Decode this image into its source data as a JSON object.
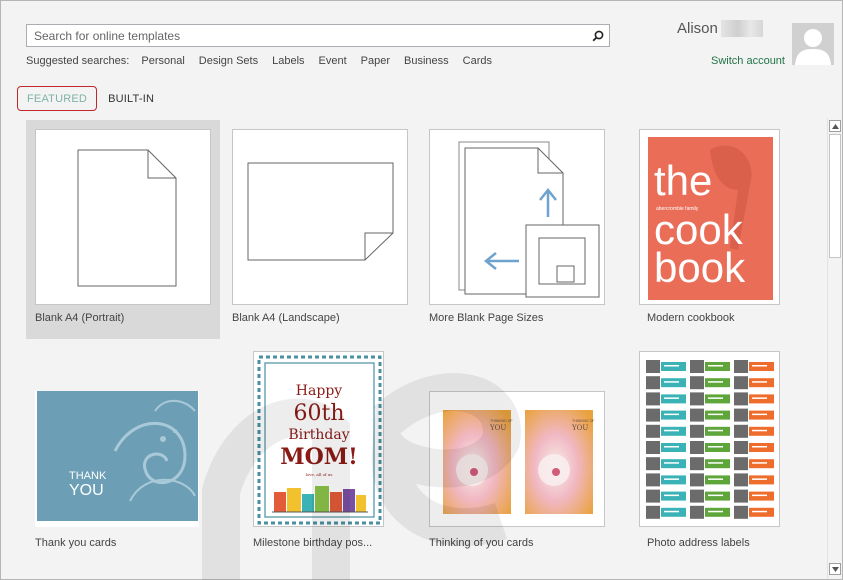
{
  "search": {
    "placeholder": "Search for online templates"
  },
  "suggested": {
    "label": "Suggested searches:",
    "items": [
      "Personal",
      "Design Sets",
      "Labels",
      "Event",
      "Paper",
      "Business",
      "Cards"
    ]
  },
  "account": {
    "name": "Alison",
    "switch_label": "Switch account"
  },
  "tabs": {
    "featured": "FEATURED",
    "builtin": "BUILT-IN"
  },
  "templates": [
    {
      "name": "Blank A4 (Portrait)",
      "selected": true
    },
    {
      "name": "Blank A4 (Landscape)"
    },
    {
      "name": "More Blank Page Sizes"
    },
    {
      "name": "Modern cookbook",
      "cover_big": [
        "the",
        "cook",
        "book"
      ],
      "cover_small": "abercrombie family"
    },
    {
      "name": "Thank you cards",
      "card_text": [
        "THANK",
        "YOU"
      ]
    },
    {
      "name": "Milestone birthday pos...",
      "poster_text": [
        "Happy",
        "60th",
        "Birthday",
        "MOM!"
      ],
      "poster_small": "love, all of us"
    },
    {
      "name": "Thinking of you cards",
      "card_text": [
        "THINKING OF",
        "YOU"
      ]
    },
    {
      "name": "Photo address labels"
    }
  ],
  "colors": {
    "accent": "#217346",
    "featured_tab": "#7fb2a7",
    "tab_highlight": "#c1272d",
    "cookbook_red": "#ea6d58",
    "thankyou_blue": "#6c9fb6",
    "arrow_blue": "#6ea3cf",
    "poster_red": "#8a1a16",
    "label_teal": "#3bb3b6",
    "label_green": "#5fa63a",
    "label_orange": "#ee6c2c"
  }
}
